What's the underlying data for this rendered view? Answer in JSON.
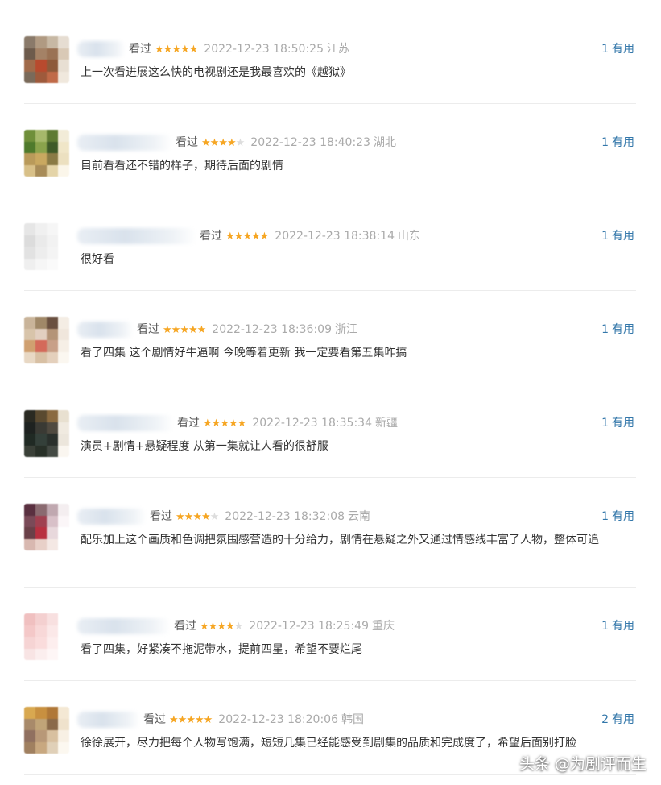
{
  "colors": {
    "star": "#f6a623",
    "link": "#3377aa",
    "text": "#333333",
    "meta": "#999999"
  },
  "comments": [
    {
      "watched": "看过",
      "rating": 5,
      "time": "2022-12-23 18:50:25",
      "location": "江苏",
      "useful_count": "1",
      "useful_label": "有用",
      "text": "上一次看进展这么快的电视剧还是我最喜欢的《越狱》"
    },
    {
      "watched": "看过",
      "rating": 4,
      "time": "2022-12-23 18:40:23",
      "location": "湖北",
      "useful_count": "1",
      "useful_label": "有用",
      "text": "目前看看还不错的样子，期待后面的剧情"
    },
    {
      "watched": "看过",
      "rating": 5,
      "time": "2022-12-23 18:38:14",
      "location": "山东",
      "useful_count": "1",
      "useful_label": "有用",
      "text": "很好看"
    },
    {
      "watched": "看过",
      "rating": 5,
      "time": "2022-12-23 18:36:09",
      "location": "浙江",
      "useful_count": "1",
      "useful_label": "有用",
      "text": "看了四集 这个剧情好牛逼啊 今晚等着更新 我一定要看第五集咋搞"
    },
    {
      "watched": "看过",
      "rating": 5,
      "time": "2022-12-23 18:35:34",
      "location": "新疆",
      "useful_count": "1",
      "useful_label": "有用",
      "text": "演员+剧情+悬疑程度 从第一集就让人看的很舒服"
    },
    {
      "watched": "看过",
      "rating": 4,
      "time": "2022-12-23 18:32:08",
      "location": "云南",
      "useful_count": "1",
      "useful_label": "有用",
      "text": "配乐加上这个画质和色调把氛围感营造的十分给力，剧情在悬疑之外又通过情感线丰富了人物，整体可追"
    },
    {
      "watched": "看过",
      "rating": 4,
      "time": "2022-12-23 18:25:49",
      "location": "重庆",
      "useful_count": "1",
      "useful_label": "有用",
      "text": "看了四集，好紧凑不拖泥带水，提前四星，希望不要烂尾"
    },
    {
      "watched": "看过",
      "rating": 5,
      "time": "2022-12-23 18:20:06",
      "location": "韩国",
      "useful_count": "2",
      "useful_label": "有用",
      "text": "徐徐展开，尽力把每个人物写饱满，短短几集已经能感受到剧集的品质和完成度了，希望后面别打脸"
    }
  ],
  "watermark": "头条 @为剧评而生"
}
